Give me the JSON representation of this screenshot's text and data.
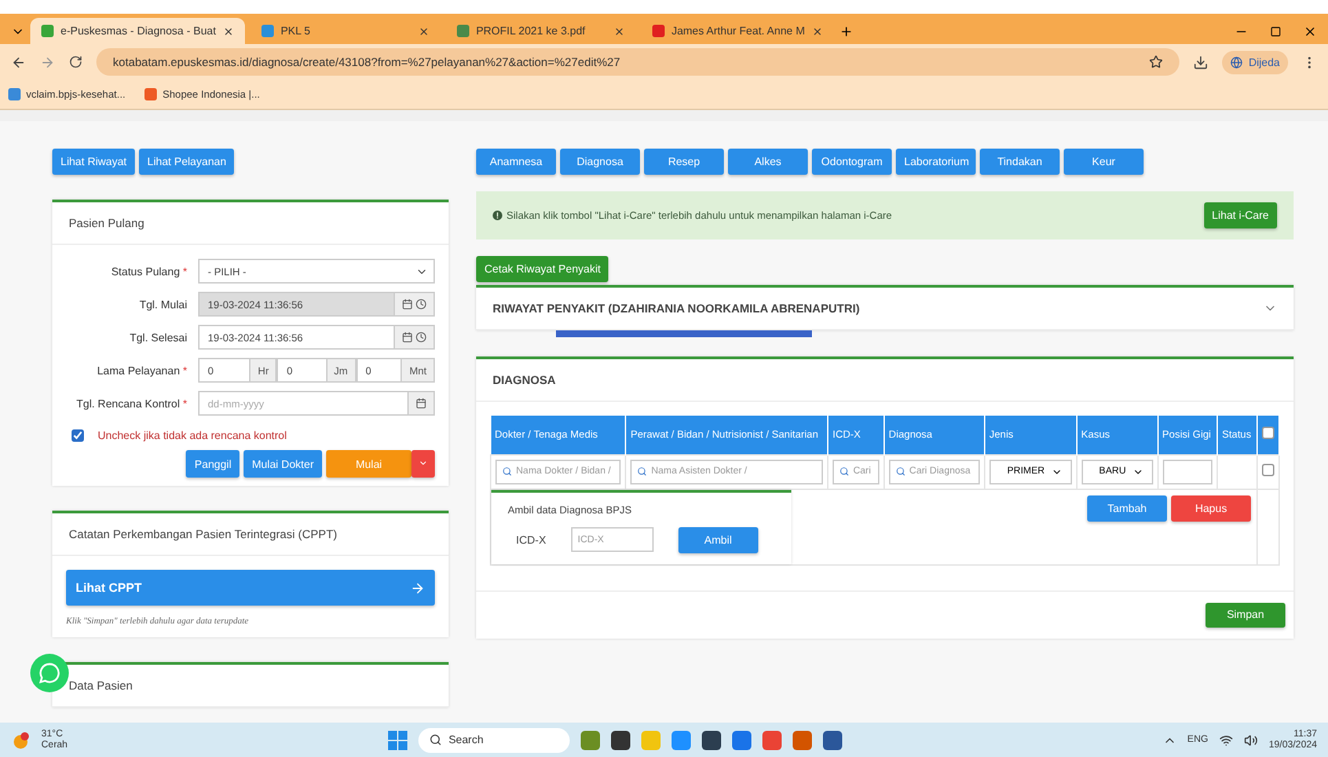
{
  "browser": {
    "tabs": [
      {
        "title": "e-Puskesmas - Diagnosa - Buat",
        "selected": true
      },
      {
        "title": "PKL 5",
        "selected": false
      },
      {
        "title": "PROFIL 2021 ke 3.pdf",
        "selected": false
      },
      {
        "title": "James Arthur Feat. Anne M",
        "selected": false
      }
    ],
    "address": "kotabatam.epuskesmas.id/diagnosa/create/43108?from=%27pelayanan%27&action=%27edit%27",
    "profile": "Dijeda",
    "bookmarks": [
      "vclaim.bpjs-kesehat...",
      "Shopee Indonesia |..."
    ]
  },
  "left": {
    "top_buttons": [
      "Lihat Riwayat",
      "Lihat Pelayanan"
    ],
    "pasien_pulang": {
      "title": "Pasien Pulang",
      "fields": [
        {
          "kind": "select",
          "label": "Status Pulang",
          "required_mark": "*",
          "value": "- PILIH -"
        },
        {
          "kind": "datetime",
          "label": "Tgl. Mulai",
          "value": "19-03-2024 11:36:56",
          "disabled": true
        },
        {
          "kind": "datetime",
          "label": "Tgl. Selesai",
          "value": "19-03-2024 11:36:56",
          "disabled": false
        },
        {
          "kind": "duration",
          "label": "Lama Pelayanan",
          "required_mark": "*",
          "parts": [
            {
              "value": "0",
              "unit": "Hr"
            },
            {
              "value": "0",
              "unit": "Jm"
            },
            {
              "value": "0",
              "unit": "Mnt"
            }
          ]
        },
        {
          "kind": "date",
          "label": "Tgl. Rencana Kontrol",
          "required_mark": "*",
          "placeholder": "dd-mm-yyyy"
        }
      ],
      "checkbox": {
        "label": "Uncheck jika tidak ada rencana kontrol",
        "checked": true
      },
      "buttons": [
        {
          "label": "Panggil",
          "kind": "primary"
        },
        {
          "label": "Mulai Dokter",
          "kind": "primary"
        },
        {
          "label": "Mulai",
          "kind": "warning"
        }
      ]
    },
    "cppt": {
      "title": "Catatan Perkembangan Pasien Terintegrasi (CPPT)",
      "button": "Lihat CPPT",
      "note": "Klik \"Simpan\" terlebih dahulu agar data terupdate"
    },
    "data_pasien": {
      "title": "Data Pasien"
    }
  },
  "right": {
    "nav_tabs": [
      "Anamnesa",
      "Diagnosa",
      "Resep",
      "Alkes",
      "Odontogram",
      "Laboratorium",
      "Tindakan",
      "Keur"
    ],
    "alert": {
      "text": "Silakan klik tombol \"Lihat i-Care\" terlebih dahulu untuk menampilkan halaman i-Care",
      "button": "Lihat i-Care"
    },
    "print_button": "Cetak Riwayat Penyakit",
    "riwayat_title": "RIWAYAT PENYAKIT (DZAHIRANIA NOORKAMILA ABRENAPUTRI)",
    "diagnosa": {
      "title": "DIAGNOSA",
      "columns": [
        "Dokter / Tenaga Medis",
        "Perawat / Bidan / Nutrisionist / Sanitarian",
        "ICD-X",
        "Diagnosa",
        "Jenis",
        "Kasus",
        "Posisi Gigi",
        "Status"
      ],
      "select_all_checked": false,
      "inputs": [
        {
          "kind": "search",
          "placeholder": "Nama Dokter / Bidan /"
        },
        {
          "kind": "search",
          "placeholder": "Nama Asisten Dokter /"
        },
        {
          "kind": "search",
          "placeholder": "Cari"
        },
        {
          "kind": "search",
          "placeholder": "Cari Diagnosa"
        },
        {
          "kind": "select",
          "value": "PRIMER"
        },
        {
          "kind": "select",
          "value": "BARU"
        },
        {
          "kind": "text"
        },
        {
          "kind": "blank"
        }
      ],
      "row_checked": false,
      "ambil": {
        "title": "Ambil data Diagnosa BPJS",
        "label": "ICD-X",
        "placeholder": "ICD-X",
        "button": "Ambil"
      },
      "row_buttons": [
        {
          "label": "Tambah",
          "kind": "primary"
        },
        {
          "label": "Hapus",
          "kind": "danger"
        }
      ],
      "save": "Simpan"
    }
  },
  "taskbar": {
    "temperature": "31°C",
    "weather": "Cerah",
    "search": "Search",
    "language": "ENG",
    "time": "11:37",
    "date": "19/03/2024"
  }
}
